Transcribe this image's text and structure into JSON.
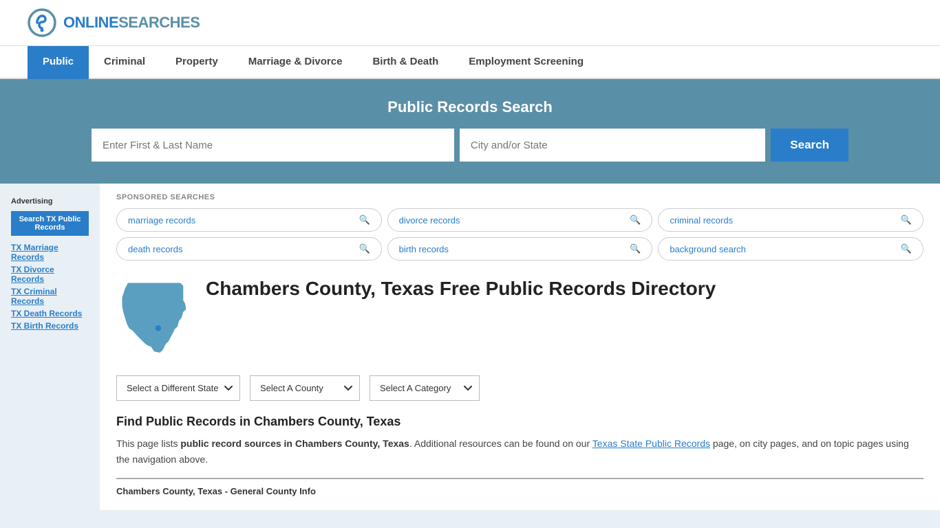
{
  "header": {
    "logo_text_plain": "ONLINE",
    "logo_text_accent": "SEARCHES"
  },
  "nav": {
    "items": [
      {
        "label": "Public",
        "active": true
      },
      {
        "label": "Criminal",
        "active": false
      },
      {
        "label": "Property",
        "active": false
      },
      {
        "label": "Marriage & Divorce",
        "active": false
      },
      {
        "label": "Birth & Death",
        "active": false
      },
      {
        "label": "Employment Screening",
        "active": false
      }
    ]
  },
  "search_banner": {
    "title": "Public Records Search",
    "name_placeholder": "Enter First & Last Name",
    "location_placeholder": "City and/or State",
    "button_label": "Search"
  },
  "sponsored": {
    "label": "SPONSORED SEARCHES",
    "tags": [
      {
        "label": "marriage records"
      },
      {
        "label": "divorce records"
      },
      {
        "label": "criminal records"
      },
      {
        "label": "death records"
      },
      {
        "label": "birth records"
      },
      {
        "label": "background search"
      }
    ]
  },
  "page": {
    "title": "Chambers County, Texas Free Public Records Directory",
    "dropdowns": {
      "state": "Select a Different State",
      "county": "Select A County",
      "category": "Select A Category"
    },
    "find_title": "Find Public Records in Chambers County, Texas",
    "find_desc_1": "This page lists ",
    "find_desc_bold": "public record sources in Chambers County, Texas",
    "find_desc_2": ". Additional resources can be found on our ",
    "find_link_text": "Texas State Public Records",
    "find_desc_3": " page, on city pages, and on topic pages using the navigation above.",
    "county_info_label": "Chambers County, Texas - General County Info"
  },
  "sidebar": {
    "ad_label": "Advertising",
    "ad_button": "Search TX Public Records",
    "links": [
      {
        "label": "TX Marriage Records"
      },
      {
        "label": "TX Divorce Records"
      },
      {
        "label": "TX Criminal Records"
      },
      {
        "label": "TX Death Records"
      },
      {
        "label": "TX Birth Records"
      }
    ]
  }
}
